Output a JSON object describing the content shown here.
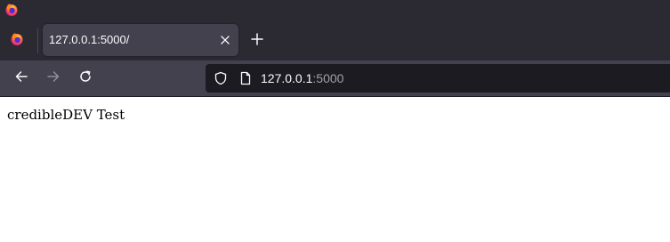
{
  "browser": {
    "tab": {
      "title": "127.0.0.1:5000/"
    },
    "address_bar": {
      "host": "127.0.0.1",
      "port": ":5000"
    },
    "icons": {
      "app": "firefox-icon",
      "tab_close": "close-icon",
      "new_tab": "plus-icon",
      "back": "back-arrow-icon",
      "forward": "forward-arrow-icon",
      "reload": "reload-icon",
      "tracking_protection": "shield-icon",
      "page": "page-icon"
    },
    "colors": {
      "chrome_dark": "#2b2a33",
      "toolbar": "#42414d",
      "url_field": "#1c1b22",
      "text_light": "#fbfbfe",
      "text_dim": "#a0a0aa"
    }
  },
  "page": {
    "body_text": "credibleDEV Test"
  }
}
